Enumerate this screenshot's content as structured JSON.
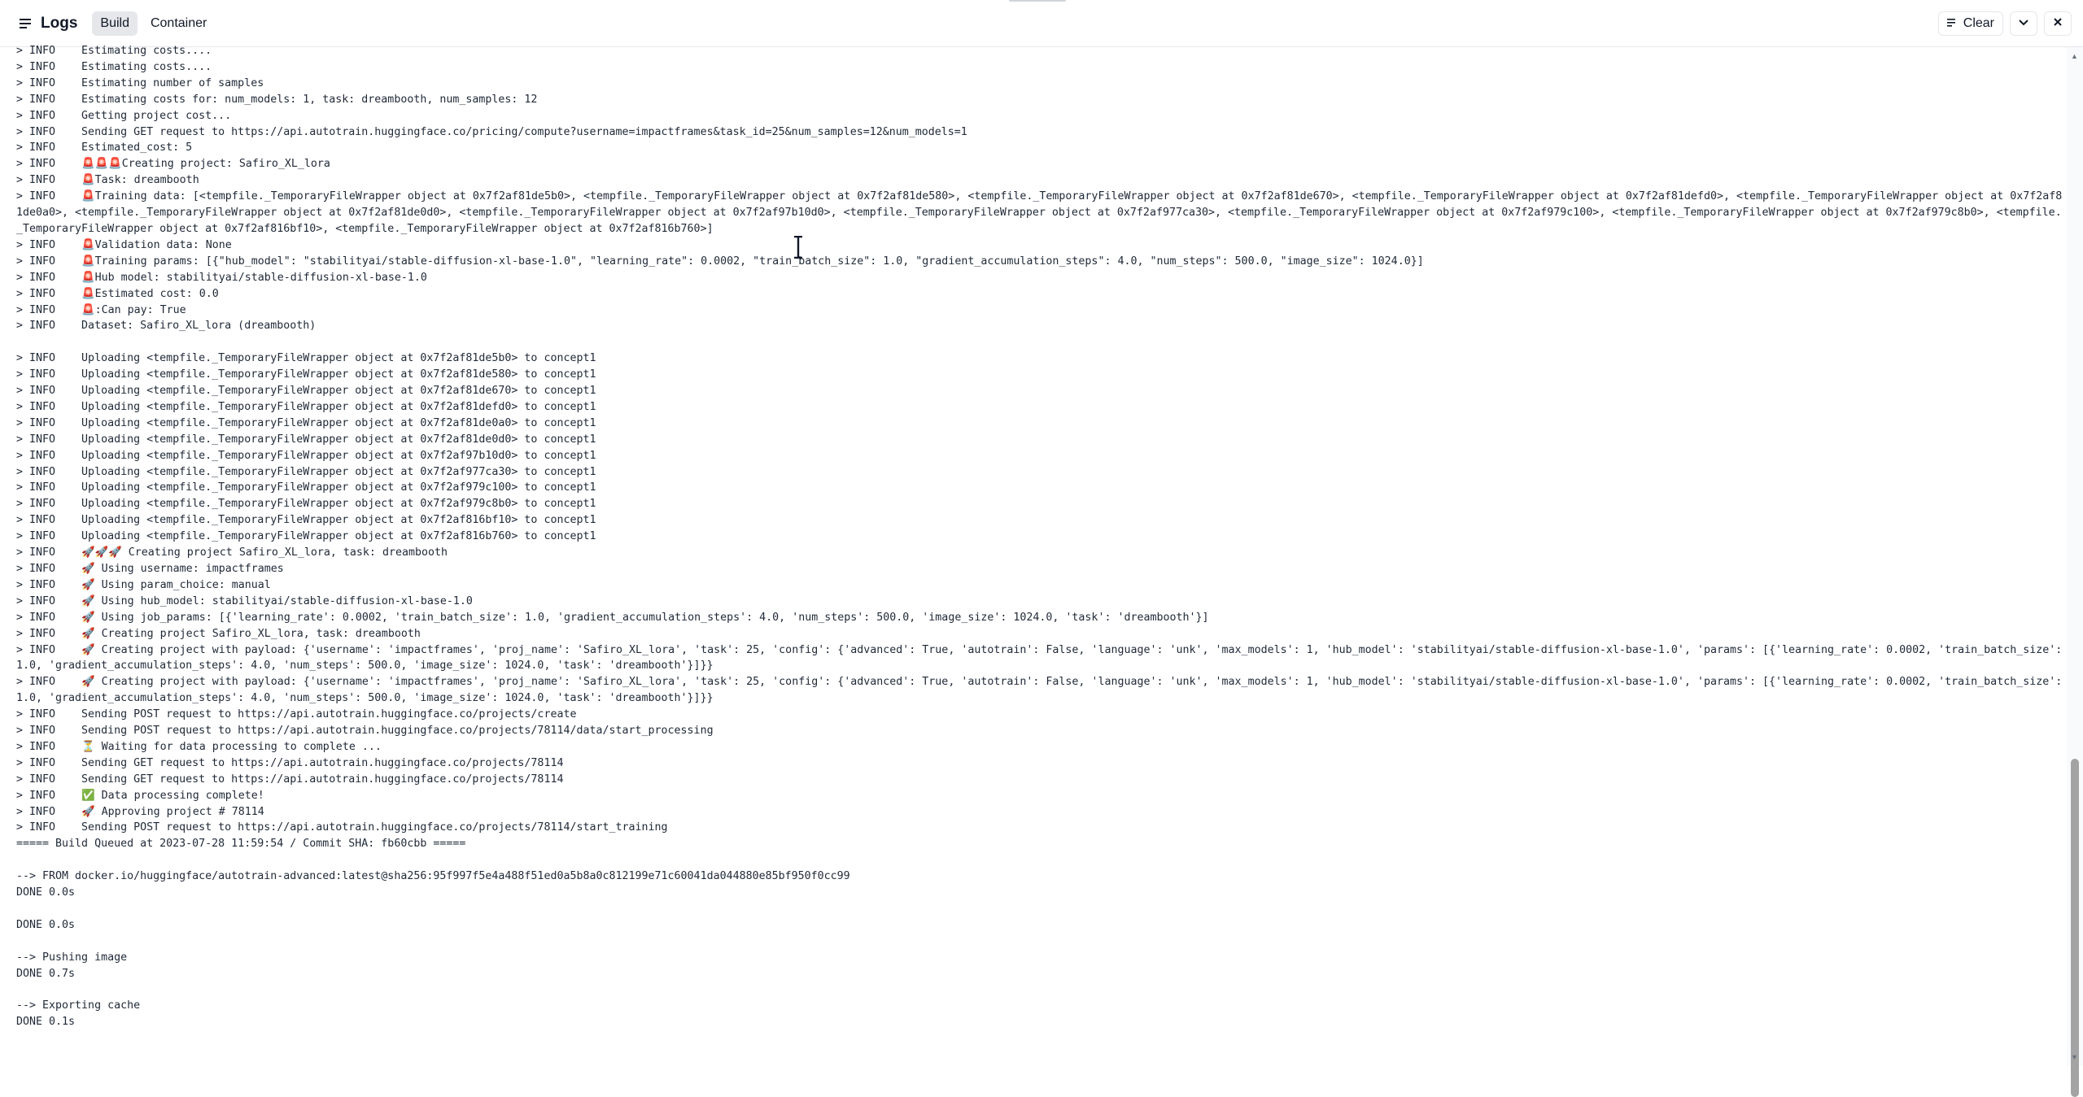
{
  "header": {
    "title": "Logs",
    "tabs": [
      "Build",
      "Container"
    ],
    "clear_label": "Clear"
  },
  "icons": {
    "logs": "list-icon",
    "clear": "clear-list-icon",
    "collapse": "chevron-down-icon",
    "close": "close-icon"
  },
  "log_lines": [
    "> INFO    Estimating costs....",
    "> INFO    Estimating costs....",
    "> INFO    Estimating number of samples",
    "> INFO    Estimating costs for: num_models: 1, task: dreambooth, num_samples: 12",
    "> INFO    Getting project cost...",
    "> INFO    Sending GET request to https://api.autotrain.huggingface.co/pricing/compute?username=impactframes&task_id=25&num_samples=12&num_models=1",
    "> INFO    Estimated_cost: 5",
    "> INFO    🚨🚨🚨Creating project: Safiro_XL_lora",
    "> INFO    🚨Task: dreambooth",
    "> INFO    🚨Training data: [<tempfile._TemporaryFileWrapper object at 0x7f2af81de5b0>, <tempfile._TemporaryFileWrapper object at 0x7f2af81de580>, <tempfile._TemporaryFileWrapper object at 0x7f2af81de670>, <tempfile._TemporaryFileWrapper object at 0x7f2af81defd0>, <tempfile._TemporaryFileWrapper object at 0x7f2af81de0a0>, <tempfile._TemporaryFileWrapper object at 0x7f2af81de0d0>, <tempfile._TemporaryFileWrapper object at 0x7f2af97b10d0>, <tempfile._TemporaryFileWrapper object at 0x7f2af977ca30>, <tempfile._TemporaryFileWrapper object at 0x7f2af979c100>, <tempfile._TemporaryFileWrapper object at 0x7f2af979c8b0>, <tempfile._TemporaryFileWrapper object at 0x7f2af816bf10>, <tempfile._TemporaryFileWrapper object at 0x7f2af816b760>]",
    "> INFO    🚨Validation data: None",
    "> INFO    🚨Training params: [{\"hub_model\": \"stabilityai/stable-diffusion-xl-base-1.0\", \"learning_rate\": 0.0002, \"train_batch_size\": 1.0, \"gradient_accumulation_steps\": 4.0, \"num_steps\": 500.0, \"image_size\": 1024.0}]",
    "> INFO    🚨Hub model: stabilityai/stable-diffusion-xl-base-1.0",
    "> INFO    🚨Estimated cost: 0.0",
    "> INFO    🚨:Can pay: True",
    "> INFO    Dataset: Safiro_XL_lora (dreambooth)",
    "",
    "> INFO    Uploading <tempfile._TemporaryFileWrapper object at 0x7f2af81de5b0> to concept1",
    "> INFO    Uploading <tempfile._TemporaryFileWrapper object at 0x7f2af81de580> to concept1",
    "> INFO    Uploading <tempfile._TemporaryFileWrapper object at 0x7f2af81de670> to concept1",
    "> INFO    Uploading <tempfile._TemporaryFileWrapper object at 0x7f2af81defd0> to concept1",
    "> INFO    Uploading <tempfile._TemporaryFileWrapper object at 0x7f2af81de0a0> to concept1",
    "> INFO    Uploading <tempfile._TemporaryFileWrapper object at 0x7f2af81de0d0> to concept1",
    "> INFO    Uploading <tempfile._TemporaryFileWrapper object at 0x7f2af97b10d0> to concept1",
    "> INFO    Uploading <tempfile._TemporaryFileWrapper object at 0x7f2af977ca30> to concept1",
    "> INFO    Uploading <tempfile._TemporaryFileWrapper object at 0x7f2af979c100> to concept1",
    "> INFO    Uploading <tempfile._TemporaryFileWrapper object at 0x7f2af979c8b0> to concept1",
    "> INFO    Uploading <tempfile._TemporaryFileWrapper object at 0x7f2af816bf10> to concept1",
    "> INFO    Uploading <tempfile._TemporaryFileWrapper object at 0x7f2af816b760> to concept1",
    "> INFO    🚀🚀🚀 Creating project Safiro_XL_lora, task: dreambooth",
    "> INFO    🚀 Using username: impactframes",
    "> INFO    🚀 Using param_choice: manual",
    "> INFO    🚀 Using hub_model: stabilityai/stable-diffusion-xl-base-1.0",
    "> INFO    🚀 Using job_params: [{'learning_rate': 0.0002, 'train_batch_size': 1.0, 'gradient_accumulation_steps': 4.0, 'num_steps': 500.0, 'image_size': 1024.0, 'task': 'dreambooth'}]",
    "> INFO    🚀 Creating project Safiro_XL_lora, task: dreambooth",
    "> INFO    🚀 Creating project with payload: {'username': 'impactframes', 'proj_name': 'Safiro_XL_lora', 'task': 25, 'config': {'advanced': True, 'autotrain': False, 'language': 'unk', 'max_models': 1, 'hub_model': 'stabilityai/stable-diffusion-xl-base-1.0', 'params': [{'learning_rate': 0.0002, 'train_batch_size': 1.0, 'gradient_accumulation_steps': 4.0, 'num_steps': 500.0, 'image_size': 1024.0, 'task': 'dreambooth'}]}}",
    "> INFO    🚀 Creating project with payload: {'username': 'impactframes', 'proj_name': 'Safiro_XL_lora', 'task': 25, 'config': {'advanced': True, 'autotrain': False, 'language': 'unk', 'max_models': 1, 'hub_model': 'stabilityai/stable-diffusion-xl-base-1.0', 'params': [{'learning_rate': 0.0002, 'train_batch_size': 1.0, 'gradient_accumulation_steps': 4.0, 'num_steps': 500.0, 'image_size': 1024.0, 'task': 'dreambooth'}]}}",
    "> INFO    Sending POST request to https://api.autotrain.huggingface.co/projects/create",
    "> INFO    Sending POST request to https://api.autotrain.huggingface.co/projects/78114/data/start_processing",
    "> INFO    ⏳ Waiting for data processing to complete ...",
    "> INFO    Sending GET request to https://api.autotrain.huggingface.co/projects/78114",
    "> INFO    Sending GET request to https://api.autotrain.huggingface.co/projects/78114",
    "> INFO    ✅ Data processing complete!",
    "> INFO    🚀 Approving project # 78114",
    "> INFO    Sending POST request to https://api.autotrain.huggingface.co/projects/78114/start_training",
    "===== Build Queued at 2023-07-28 11:59:54 / Commit SHA: fb60cbb =====",
    "",
    "--> FROM docker.io/huggingface/autotrain-advanced:latest@sha256:95f997f5e4a488f51ed0a5b8a0c812199e71c60041da044880e85bf950f0cc99",
    "DONE 0.0s",
    "",
    "DONE 0.0s",
    "",
    "--> Pushing image",
    "DONE 0.7s",
    "",
    "--> Exporting cache",
    "DONE 0.1s"
  ]
}
